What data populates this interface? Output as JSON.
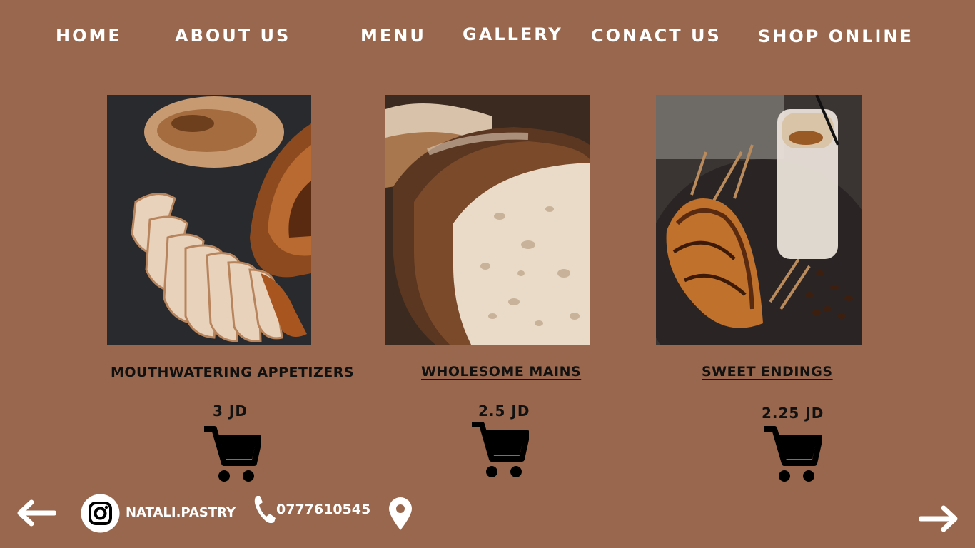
{
  "nav": {
    "home": "HOME",
    "about": "ABOUT US",
    "menu": "MENU",
    "gallery": "GALLERY",
    "contact": "CONACT US",
    "shop": "SHOP ONLINE"
  },
  "products": [
    {
      "title": "MOUTHWATERING APPETIZERS",
      "price": "3 JD",
      "image": "grilled-chicken"
    },
    {
      "title": "WHOLESOME MAINS",
      "price": "2.5 JD",
      "image": "sourdough-bread"
    },
    {
      "title": "SWEET ENDINGS",
      "price": "2.25 JD",
      "image": "croissant-and-latte"
    }
  ],
  "footer": {
    "instagram": "NATALI.PASTRY",
    "phone": "0777610545"
  },
  "icons": {
    "prev": "arrow-left-icon",
    "next": "arrow-right-icon",
    "instagram": "instagram-icon",
    "phone": "phone-icon",
    "location": "location-pin-icon",
    "cart": "cart-icon"
  },
  "colors": {
    "background": "#98674d",
    "text_light": "#ffffff",
    "text_dark": "#111111"
  }
}
